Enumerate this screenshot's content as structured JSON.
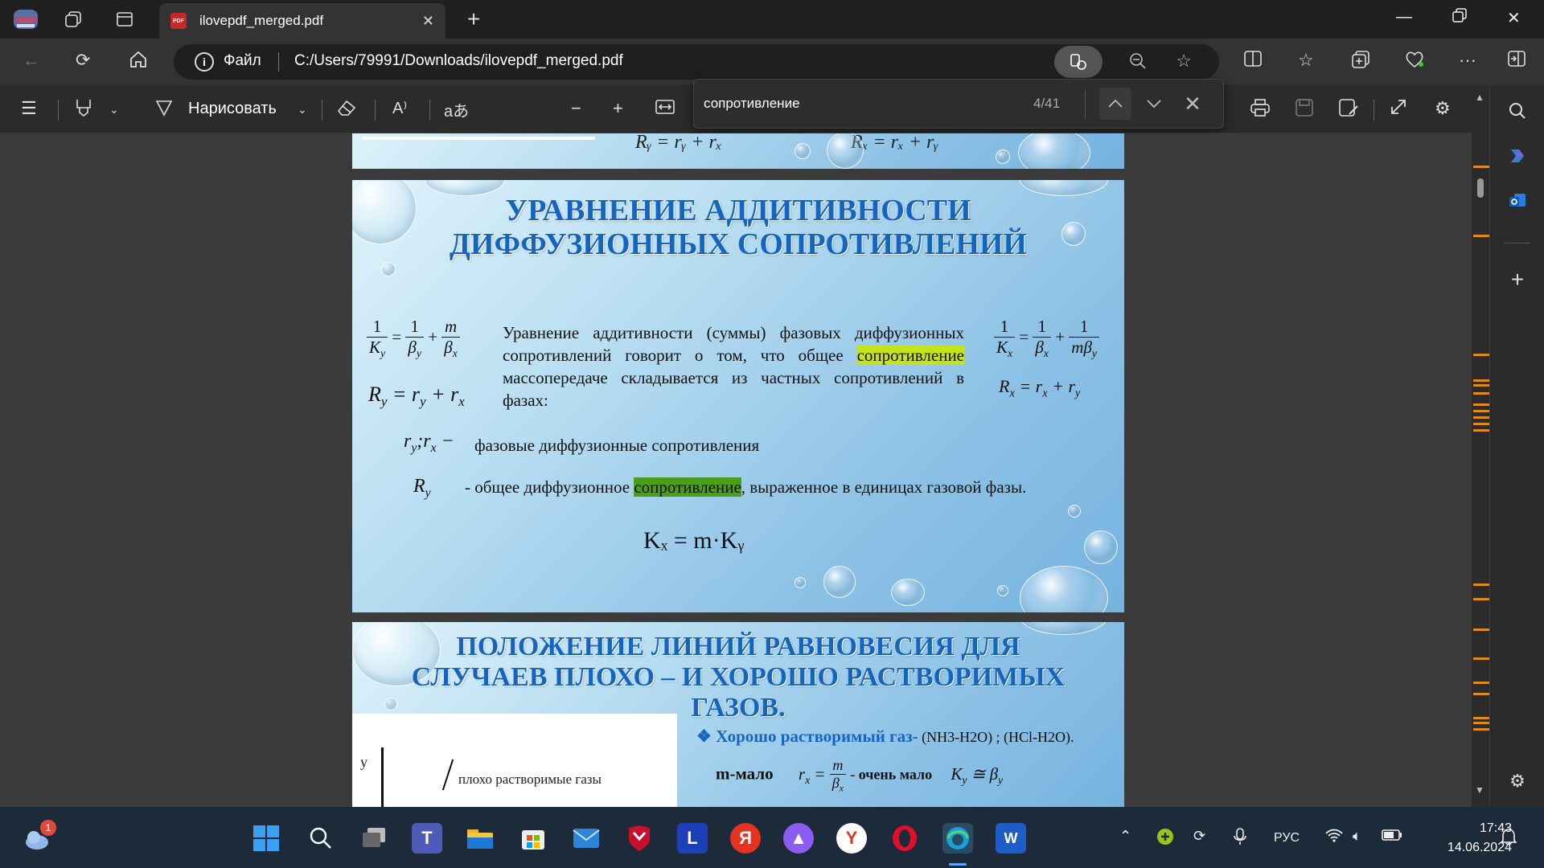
{
  "browser": {
    "tab_title": "ilovepdf_merged.pdf",
    "tab_icon_text": "PDF",
    "address_label": "Файл",
    "url": "C:/Users/79991/Downloads/ilovepdf_merged.pdf"
  },
  "pdf_toolbar": {
    "draw_label": "Нарисовать",
    "translate_label": "aあ",
    "read_aloud_label": "A⁾"
  },
  "find": {
    "query": "сопротивление",
    "count": "4/41"
  },
  "slide1": {
    "eq_left": "Rᵧ = rᵧ + rₓ",
    "eq_right": "Rₓ = rₓ + rᵧ"
  },
  "slide2": {
    "title_line1": "УРАВНЕНИЕ АДДИТИВНОСТИ",
    "title_line2": "ДИФФУЗИОННЫХ СОПРОТИВЛЕНИЙ",
    "body_part1": "Уравнение аддитивности (суммы) фазовых диффузионных сопротивлений говорит о том, что общее ",
    "body_highlight": "сопротивление",
    "body_part2": " массопередаче складывается из частных сопротивлений в фазах:",
    "line_r_text": "фазовые диффузионные сопротивления",
    "line_R_part1": "- общее диффузионное ",
    "line_R_highlight": "сопротивление",
    "line_R_part2": ", выраженное в единицах газовой фазы.",
    "formula_bottom": "Kₓ = m·Kᵧ"
  },
  "slide3": {
    "title_line1": "ПОЛОЖЕНИЕ ЛИНИЙ РАВНОВЕСИЯ ДЛЯ",
    "title_line2": "СЛУЧАЕВ ПЛОХО – И ХОРОШО РАСТВОРИМЫХ",
    "title_line3": "ГАЗОВ.",
    "graph_y": "y",
    "graph_label": "плохо растворимые газы",
    "bullet_bold": "❖ Хорошо растворимый газ-",
    "bullet_rest": " (NH3-H2O) ; (HCl-H2O).",
    "row_left": "m-мало",
    "row_mid": "- очень мало"
  },
  "taskbar": {
    "notification_badge": "1",
    "lang": "РУС",
    "time": "17:43",
    "date": "14.06.2024"
  },
  "colors": {
    "highlight_current": "#4a9e1a",
    "highlight_other": "#c6e21a",
    "title_blue": "#1565c0",
    "scroll_marks": "#e08a1a"
  }
}
